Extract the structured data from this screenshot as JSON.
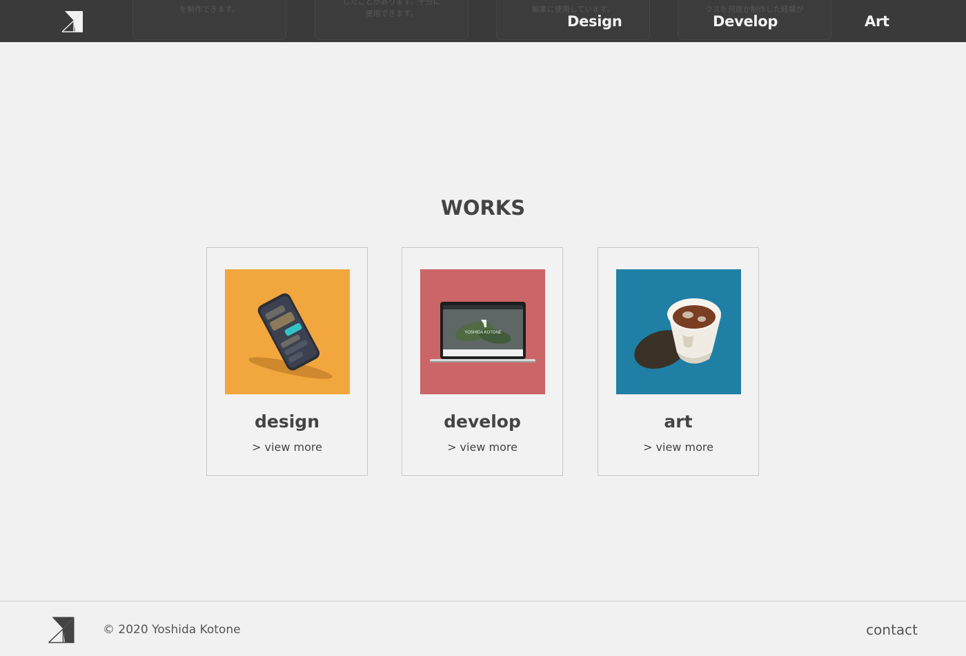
{
  "header": {
    "background_cards": [
      {
        "text": "を制作できます。"
      },
      {
        "text": "したことがあります。十分に\n使用できます。"
      },
      {
        "text": "編集に使用しています。"
      },
      {
        "text": "クスを何度か制作した経験が"
      }
    ],
    "nav": {
      "design": "Design",
      "develop": "Develop",
      "art": "Art"
    }
  },
  "works": {
    "title": "WORKS",
    "cards": [
      {
        "title": "design",
        "more": "> view more",
        "image_color": "#f2a63e"
      },
      {
        "title": "develop",
        "more": "> view more",
        "image_color": "#cc6567"
      },
      {
        "title": "art",
        "more": "> view more",
        "image_color": "#1f7fa5"
      }
    ],
    "laptop_screen_text": "YOSHIDA KOTONE"
  },
  "footer": {
    "copyright": "© 2020 Yoshida Kotone",
    "contact": "contact"
  },
  "colors": {
    "header_bg": "#3a3a3a",
    "page_bg": "#f1f1f1",
    "text": "#444444"
  }
}
